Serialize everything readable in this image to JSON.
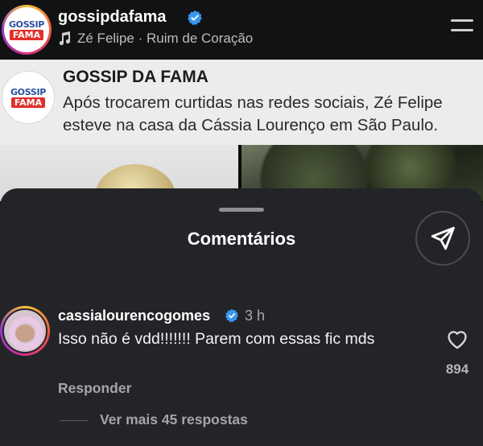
{
  "post": {
    "username": "gossipdafama",
    "music": "Zé Felipe · Ruim de Coração",
    "logo_top": "GOSSIP",
    "logo_bottom": "FAMA"
  },
  "article": {
    "title": "GOSSIP DA FAMA",
    "text": "Após trocarem curtidas nas redes sociais, Zé Felipe esteve na casa da Cássia Lourenço em São Paulo."
  },
  "sheet": {
    "title": "Comentários"
  },
  "comment": {
    "username": "cassialourencogomes",
    "time": "3 h",
    "text": "Isso não é vdd!!!!!!! Parem com essas fic mds",
    "reply_label": "Responder",
    "likes": "894",
    "more_replies": "Ver mais 45 respostas"
  },
  "colors": {
    "verified": "#3797f0",
    "sheet_bg": "#232428",
    "logo_red": "#e0302a",
    "logo_blue": "#2a4f9e"
  },
  "icons": [
    "verified-badge-icon",
    "music-note-icon",
    "menu-icon",
    "send-icon",
    "heart-icon"
  ]
}
